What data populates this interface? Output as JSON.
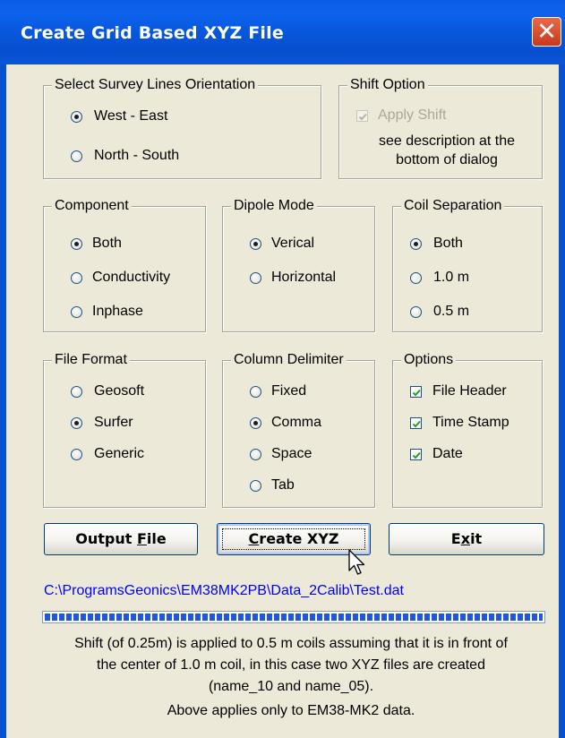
{
  "window": {
    "title": "Create Grid Based XYZ File",
    "close_glyph": "✕"
  },
  "orientation": {
    "label": "Select Survey Lines Orientation",
    "options": [
      {
        "label": "West - East",
        "selected": true
      },
      {
        "label": "North - South",
        "selected": false
      }
    ]
  },
  "shift": {
    "label": "Shift Option",
    "checkbox_label": "Apply Shift",
    "checked": true,
    "enabled": false,
    "note_line1": "see description at the",
    "note_line2": "bottom of dialog"
  },
  "component": {
    "label": "Component",
    "options": [
      {
        "label": "Both",
        "selected": true
      },
      {
        "label": "Conductivity",
        "selected": false
      },
      {
        "label": "Inphase",
        "selected": false
      }
    ]
  },
  "dipole": {
    "label": "Dipole Mode",
    "options": [
      {
        "label": "Verical",
        "selected": true
      },
      {
        "label": "Horizontal",
        "selected": false
      }
    ]
  },
  "coil": {
    "label": "Coil Separation",
    "options": [
      {
        "label": "Both",
        "selected": true
      },
      {
        "label": "1.0 m",
        "selected": false
      },
      {
        "label": "0.5 m",
        "selected": false
      }
    ]
  },
  "format": {
    "label": "File Format",
    "options": [
      {
        "label": "Geosoft",
        "selected": false
      },
      {
        "label": "Surfer",
        "selected": true
      },
      {
        "label": "Generic",
        "selected": false
      }
    ]
  },
  "delimiter": {
    "label": "Column Delimiter",
    "options": [
      {
        "label": "Fixed",
        "selected": false
      },
      {
        "label": "Comma",
        "selected": true
      },
      {
        "label": "Space",
        "selected": false
      },
      {
        "label": "Tab",
        "selected": false
      }
    ]
  },
  "options": {
    "label": "Options",
    "items": [
      {
        "label": "File Header",
        "checked": true
      },
      {
        "label": "Time Stamp",
        "checked": true
      },
      {
        "label": "Date",
        "checked": true
      }
    ]
  },
  "buttons": {
    "output_file": {
      "pre": "Output ",
      "accel": "F",
      "post": "ile"
    },
    "create_xyz": {
      "pre": "",
      "accel": "C",
      "post": "reate XYZ"
    },
    "exit": {
      "pre": "E",
      "accel": "x",
      "post": "it"
    }
  },
  "output_path": "C:\\ProgramsGeonics\\EM38MK2PB\\Data_2Calib\\Test.dat",
  "progress": 1.0,
  "description": {
    "line1": "Shift (of 0.25m) is applied to 0.5 m coils assuming that it is in front of",
    "line2": "the center of 1.0 m coil,  in this case two XYZ files are created",
    "line3": "(name_10 and name_05).",
    "line4": "Above applies only to EM38-MK2 data."
  },
  "colors": {
    "title_bar": "#0755d9",
    "dialog_bg": "#ece9d8",
    "path_text": "#0000ff",
    "progress_fill": "#2358d5",
    "close_button": "#c9391b"
  }
}
